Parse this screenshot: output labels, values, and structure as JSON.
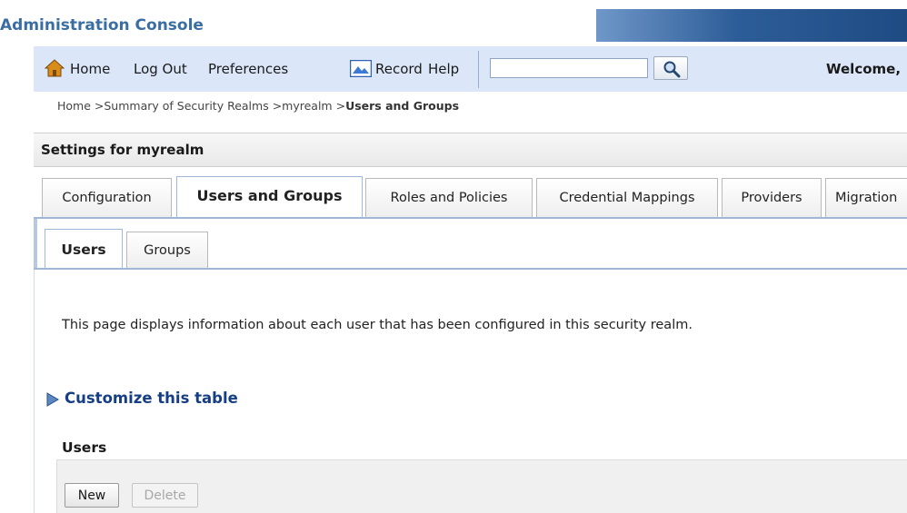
{
  "app": {
    "title": "Administration Console"
  },
  "toolbar": {
    "home": "Home",
    "logout": "Log Out",
    "preferences": "Preferences",
    "record": "Record",
    "help": "Help",
    "search_value": "",
    "welcome": "Welcome,"
  },
  "breadcrumb": {
    "home": "Home",
    "realms": "Summary of Security Realms",
    "realm": "myrealm",
    "current": "Users and Groups",
    "separator": " >"
  },
  "settings": {
    "title": "Settings for myrealm",
    "tabs": [
      {
        "label": "Configuration",
        "active": false
      },
      {
        "label": "Users and Groups",
        "active": true
      },
      {
        "label": "Roles and Policies",
        "active": false
      },
      {
        "label": "Credential Mappings",
        "active": false
      },
      {
        "label": "Providers",
        "active": false
      },
      {
        "label": "Migration",
        "active": false
      }
    ],
    "subtabs": [
      {
        "label": "Users",
        "active": true
      },
      {
        "label": "Groups",
        "active": false
      }
    ]
  },
  "content": {
    "description": "This page displays information about each user that has been configured in this security realm.",
    "customize_link": "Customize this table",
    "section_title": "Users",
    "buttons": {
      "new": "New",
      "delete": "Delete"
    }
  },
  "colors": {
    "title": "#3a6ea3",
    "toolbar_bg": "#dbe7f8",
    "link": "#153e85",
    "tab_border_active": "#9fb7d8"
  }
}
